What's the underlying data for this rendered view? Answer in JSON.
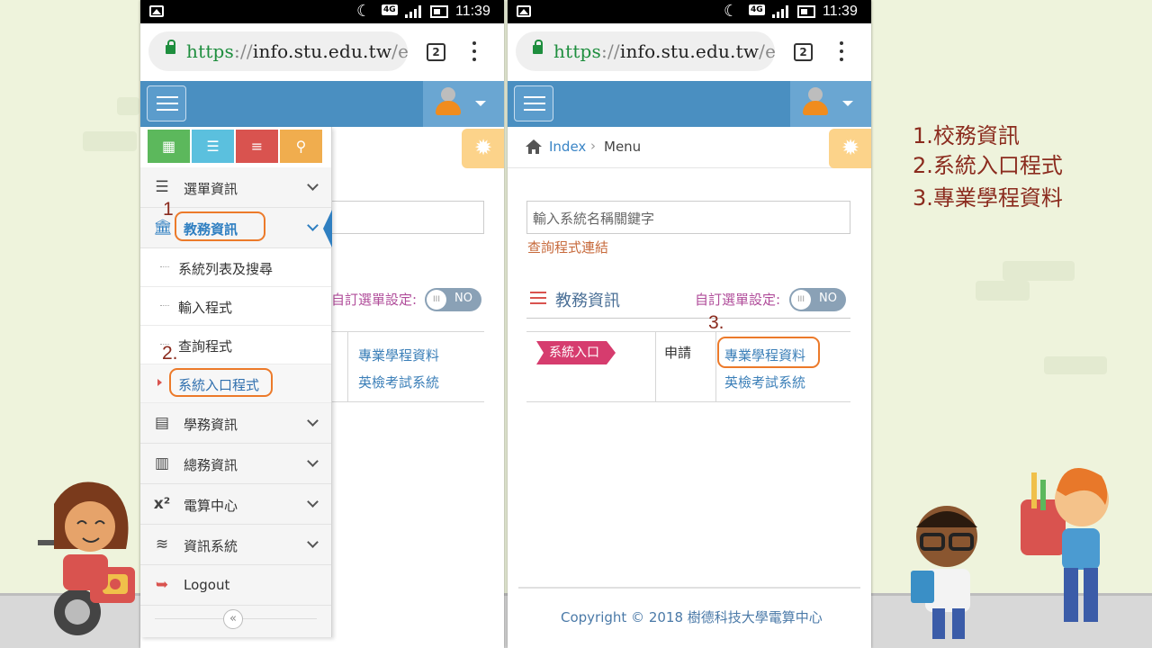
{
  "status_bar": {
    "time": "11:39",
    "network": "4G"
  },
  "browser": {
    "url_scheme": "https",
    "url_sep": "://",
    "url_host": "info.stu.edu.tw",
    "url_rest": "/e",
    "tab_count": "2"
  },
  "left_screen": {
    "sidebar": {
      "menu_top": {
        "label": "選單資訊",
        "icon": "bars-icon"
      },
      "active_menu": {
        "label": "教務資訊",
        "icon": "bank-icon"
      },
      "sub_items": [
        "系統列表及搜尋",
        "輸入程式",
        "查詢程式",
        "系統入口程式"
      ],
      "menus": [
        {
          "label": "學務資訊",
          "icon": "list-alt-icon"
        },
        {
          "label": "總務資訊",
          "icon": "building-icon"
        },
        {
          "label": "電算中心",
          "icon": "superscript-icon"
        },
        {
          "label": "資訊系統",
          "icon": "stack-icon"
        }
      ],
      "logout": "Logout",
      "collapse_glyph": "«",
      "shortcut_colors": [
        "#5cb85c",
        "#5bc0de",
        "#d9534f",
        "#f0ad4e"
      ]
    },
    "custom_menu_label": "自訂選單設定:",
    "toggle_text": "NO",
    "links": [
      "專業學程資料",
      "英檢考試系統"
    ]
  },
  "right_screen": {
    "breadcrumb": {
      "home": "Index",
      "separator": "›",
      "current": "Menu"
    },
    "search_placeholder": "輸入系統名稱關鍵字",
    "query_link": "查詢程式連結",
    "section_title": "教務資訊",
    "custom_menu_label": "自訂選單設定:",
    "toggle_text": "NO",
    "tag": "系統入口",
    "apply_label": "申請",
    "links": [
      "專業學程資料",
      "英檢考試系統"
    ],
    "footer": "Copyright © 2018 樹德科技大學電算中心"
  },
  "step_labels": {
    "step1": "1",
    "step2": "2.",
    "step3": "3."
  },
  "annotations": [
    "1.校務資訊",
    "2.系統入口程式",
    "3.專業學程資料"
  ],
  "colors": {
    "appbar": "#4a8fc1",
    "highlight": "#ec7a2a",
    "annotation": "#8b2b1e"
  }
}
